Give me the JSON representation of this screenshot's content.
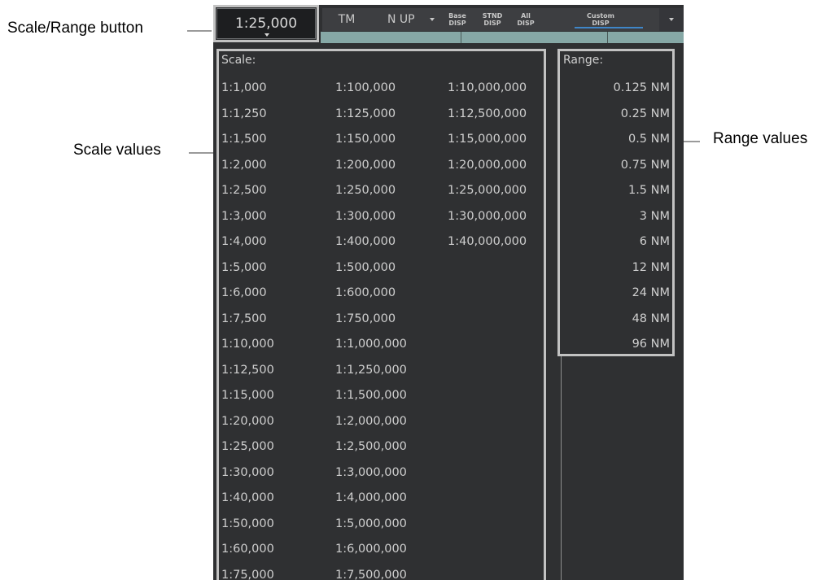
{
  "callouts": {
    "scale_range_button": "Scale/Range button",
    "scale_values": "Scale values",
    "range_values": "Range values"
  },
  "toolbar": {
    "scale_button_value": "1:25,000",
    "tm_label": "TM",
    "nup_label": "N UP",
    "base_line1": "Base",
    "base_line2": "DISP",
    "stnd_line1": "STND",
    "stnd_line2": "DISP",
    "all_line1": "All",
    "all_line2": "DISP",
    "custom_line1": "Custom",
    "custom_line2": "DISP"
  },
  "panel": {
    "scale_heading": "Scale:",
    "range_heading": "Range:",
    "scale_col1": [
      "1:1,000",
      "1:1,250",
      "1:1,500",
      "1:2,000",
      "1:2,500",
      "1:3,000",
      "1:4,000",
      "1:5,000",
      "1:6,000",
      "1:7,500",
      "1:10,000",
      "1:12,500",
      "1:15,000",
      "1:20,000",
      "1:25,000",
      "1:30,000",
      "1:40,000",
      "1:50,000",
      "1:60,000",
      "1:75,000"
    ],
    "scale_col2": [
      "1:100,000",
      "1:125,000",
      "1:150,000",
      "1:200,000",
      "1:250,000",
      "1:300,000",
      "1:400,000",
      "1:500,000",
      "1:600,000",
      "1:750,000",
      "1:1,000,000",
      "1:1,250,000",
      "1:1,500,000",
      "1:2,000,000",
      "1:2,500,000",
      "1:3,000,000",
      "1:4,000,000",
      "1:5,000,000",
      "1:6,000,000",
      "1:7,500,000"
    ],
    "scale_col3": [
      "1:10,000,000",
      "1:12,500,000",
      "1:15,000,000",
      "1:20,000,000",
      "1:25,000,000",
      "1:30,000,000",
      "1:40,000,000"
    ],
    "range_values": [
      "0.125 NM",
      "0.25 NM",
      "0.5 NM",
      "0.75 NM",
      "1.5 NM",
      "3 NM",
      "6 NM",
      "12 NM",
      "24 NM",
      "48 NM",
      "96 NM"
    ]
  },
  "colors": {
    "panel_bg": "#2f3032",
    "highlight_frame": "#c2c2c2",
    "text": "#cfcfcf",
    "accent_underline": "#3f86c8",
    "status_strip": "#86a8a6"
  }
}
